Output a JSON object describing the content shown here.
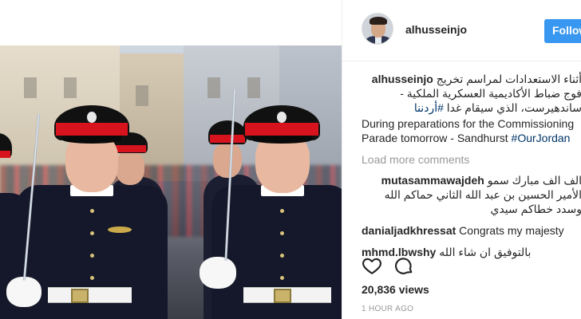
{
  "post": {
    "username": "alhusseinjo",
    "follow_label": "Follow",
    "caption_user": "alhusseinjo",
    "caption_ar_line": "أثناء الاستعدادات لمراسم تخريج فوج ضباط الأكاديمية العسكرية الملكية - ساندهيرست، الذي سيقام غدا",
    "caption_ar_tag": "#أردننا",
    "caption_en_text": "During preparations for the Commissioning Parade tomorrow - Sandhurst ",
    "caption_en_tag": "#OurJordan",
    "load_more_label": "Load more comments",
    "comments": [
      {
        "user": "mutasammawajdeh",
        "text": "الف الف مبارك سمو الأمير الحسين بن عبد الله الثاني حماكم الله وسدد خطاكم سيدي"
      },
      {
        "user": "danialjadkhressat",
        "text": "Congrats my majesty"
      },
      {
        "user": "mhmd.lbwshy",
        "text": "بالتوفيق ان شاء الله"
      }
    ],
    "views": "20,836 views",
    "time": "1 HOUR AGO"
  },
  "icons": {
    "like": "heart-icon",
    "comment": "comment-bubble-icon"
  },
  "colors": {
    "follow_button": "#3897f0",
    "hashtag": "#003569",
    "muted": "#999999"
  }
}
